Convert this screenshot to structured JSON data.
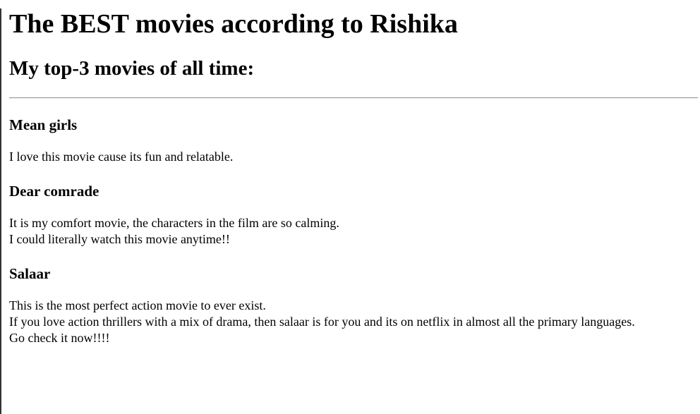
{
  "page": {
    "title": "The BEST movies according to Rishika",
    "subtitle": "My top-3 movies of all time:"
  },
  "movies": [
    {
      "title": "Mean girls",
      "lines": [
        "I love this movie cause its fun and relatable."
      ]
    },
    {
      "title": "Dear comrade",
      "lines": [
        "It is my comfort movie, the characters in the film are so calming.",
        "I could literally watch this movie anytime!!"
      ]
    },
    {
      "title": "Salaar",
      "lines": [
        "This is the most perfect action movie to ever exist.",
        "If you love action thrillers with a mix of drama, then salaar is for you and its on netflix in almost all the primary languages.",
        "Go check it now!!!!"
      ]
    }
  ]
}
